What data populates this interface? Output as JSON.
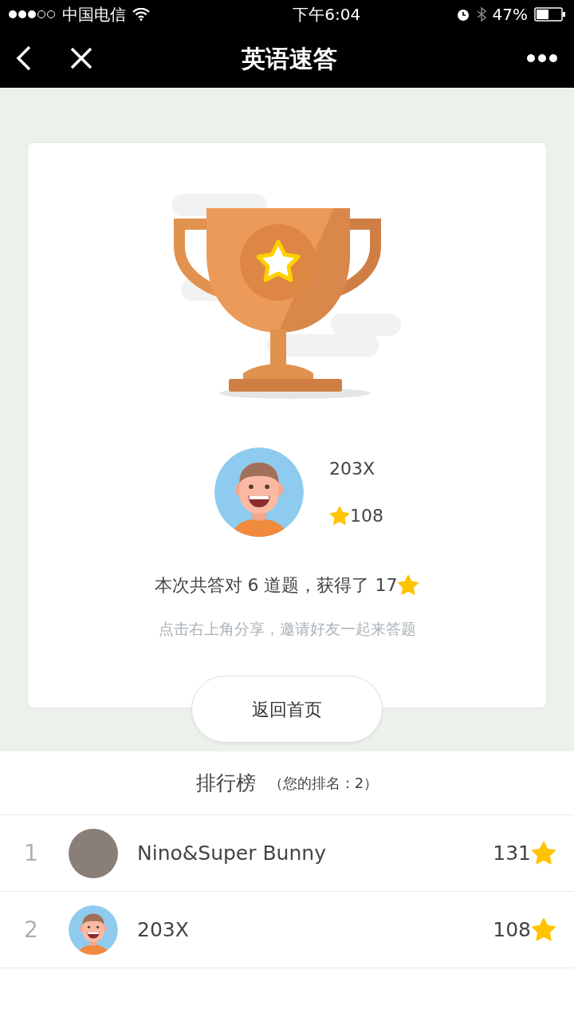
{
  "status_bar": {
    "carrier": "中国电信",
    "time": "下午6:04",
    "battery": "47%"
  },
  "nav": {
    "title": "英语速答"
  },
  "player": {
    "name": "203X",
    "stars": "108",
    "avatar": {
      "kind": "cartoon"
    }
  },
  "result": {
    "text": "本次共答对 6 道题，获得了 17",
    "hint": "点击右上角分享，邀请好友一起来答题"
  },
  "home_button": "返回首页",
  "ranking": {
    "title": "排行榜",
    "my_rank": "（您的排名：2）",
    "rows": [
      {
        "rank": "1",
        "name": "Nino&Super Bunny",
        "score": "131",
        "avatar": {
          "kind": "photo"
        }
      },
      {
        "rank": "2",
        "name": "203X",
        "score": "108",
        "avatar": {
          "kind": "cartoon"
        }
      }
    ]
  }
}
